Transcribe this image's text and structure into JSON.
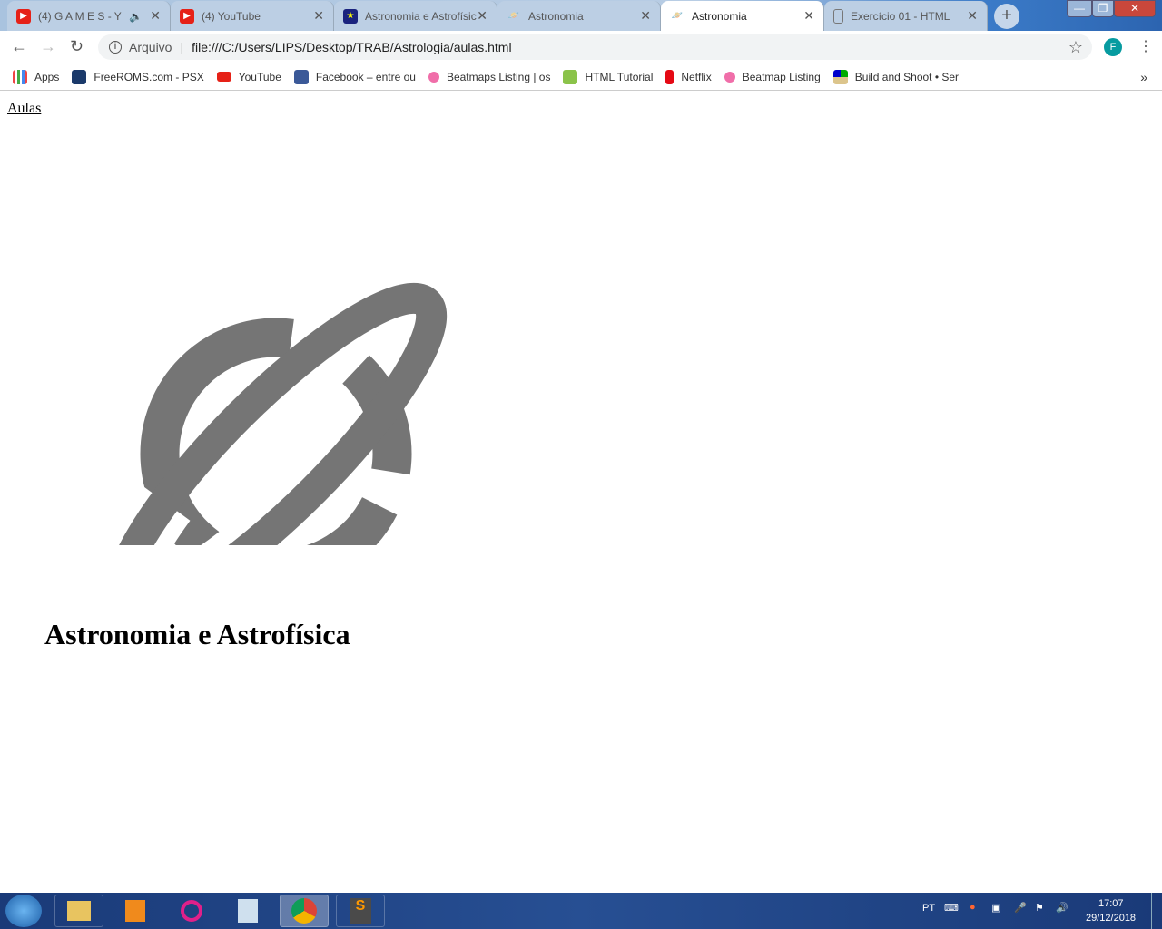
{
  "tabs": [
    {
      "title": "(4) G A M E S - Y",
      "icon": "youtube-icon",
      "audio": true
    },
    {
      "title": "(4) YouTube",
      "icon": "youtube-icon"
    },
    {
      "title": "Astronomia e Astrofísica",
      "icon": "star-icon"
    },
    {
      "title": "Astronomia",
      "icon": "planet-icon"
    },
    {
      "title": "Astronomia",
      "icon": "planet-icon",
      "active": true
    },
    {
      "title": "Exercício 01 - HTML",
      "icon": "file-icon"
    }
  ],
  "address": {
    "security_label": "Arquivo",
    "url": "file:///C:/Users/LIPS/Desktop/TRAB/Astrologia/aulas.html"
  },
  "profile_initial": "F",
  "bookmarks": [
    "Apps",
    "FreeROMS.com - PSX",
    "YouTube",
    "Facebook – entre ou",
    "Beatmaps Listing | os",
    "HTML Tutorial",
    "Netflix",
    "Beatmap Listing",
    "Build and Shoot • Ser"
  ],
  "page": {
    "link": "Aulas",
    "heading": "Astronomia e Astrofísica",
    "icon_color": "#757575"
  },
  "taskbar": {
    "lang": "PT",
    "time": "17:07",
    "date": "29/12/2018"
  }
}
